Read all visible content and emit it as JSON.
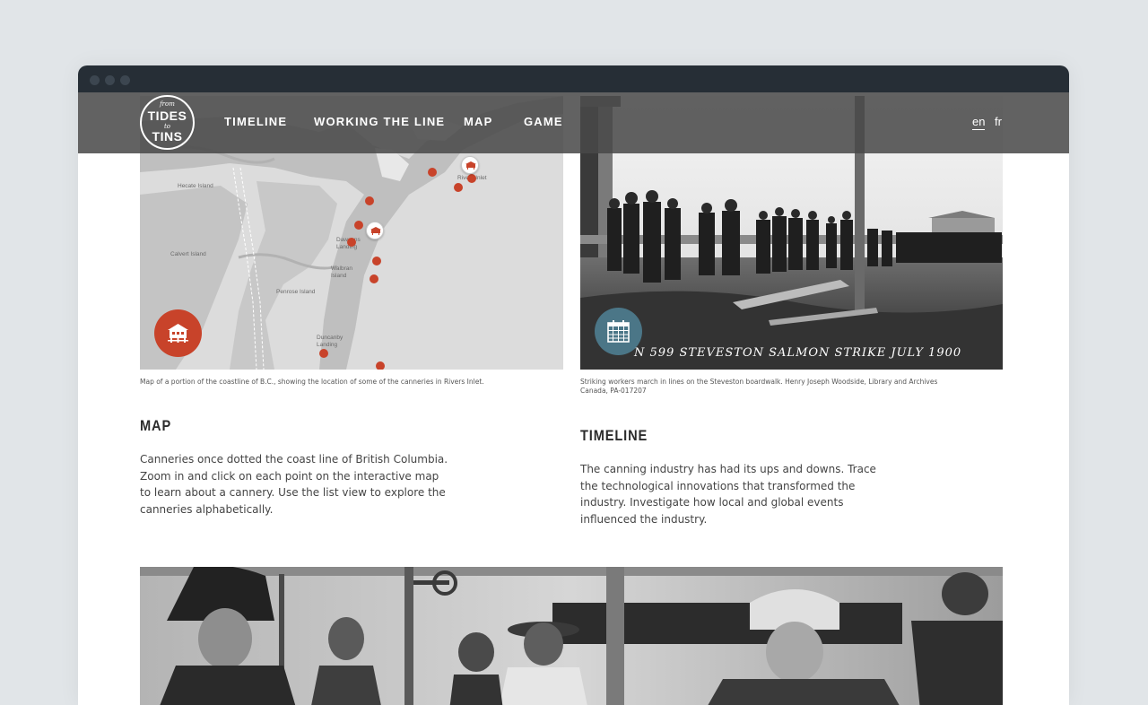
{
  "colors": {
    "desktop_background": "#e1e5e8",
    "window_chrome": "#262e36",
    "navbar_background": "#484848",
    "map_accent": "#c8432a",
    "timeline_accent": "#4b7687"
  },
  "nav": {
    "logo_text": {
      "top": "from",
      "line1": "TIDES",
      "middle": "to",
      "line2": "TINS"
    },
    "links": [
      "TIMELINE",
      "WORKING THE LINE",
      "MAP",
      "GAME"
    ],
    "languages": {
      "active": "en",
      "other": "fr"
    }
  },
  "map_card": {
    "icon": "cannery-building-icon",
    "places": [
      "Hecate Island",
      "Calvert Island",
      "Dawsons Landing",
      "Walbran Island",
      "Penrose Island",
      "Duncanby Landing",
      "Rivers Inlet"
    ],
    "caption": "Map of a portion of the coastline of B.C., showing the location of some of the canneries in Rivers Inlet.",
    "heading": "MAP",
    "body": "Canneries once dotted the coast line of British Columbia. Zoom in and click on each point on the interactive map to learn about a cannery. Use the list view to explore the canneries alphabetically."
  },
  "timeline_card": {
    "icon": "calendar-icon",
    "photo_inscription": "N 599 STEVESTON SALMON STRIKE JULY 1900",
    "caption": "Striking workers march in lines on the Steveston boardwalk. Henry Joseph Woodside, Library and Archives Canada, PA-017207",
    "heading": "TIMELINE",
    "body": "The canning industry has had its ups and downs. Trace the technological innovations that transformed the industry. Investigate how local and global events influenced the industry."
  },
  "bottom_photo": {
    "subject": "cannery-workers-photo"
  }
}
